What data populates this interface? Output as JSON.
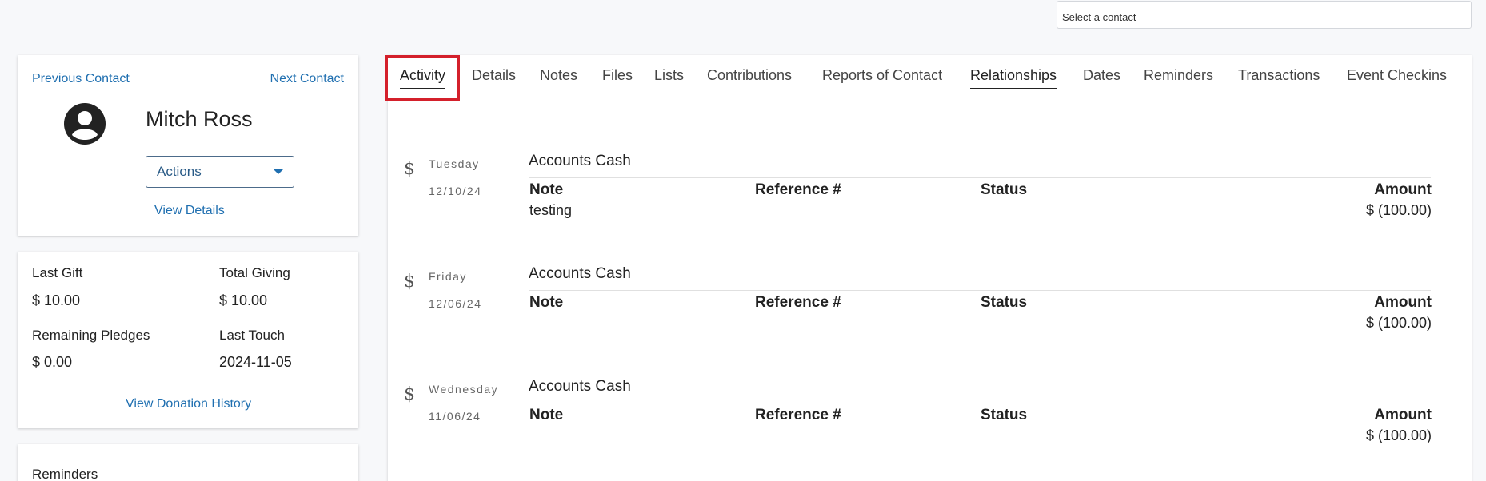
{
  "contact_select": {
    "placeholder": "Select a contact"
  },
  "contact_card": {
    "previous_label": "Previous Contact",
    "next_label": "Next Contact",
    "name": "Mitch Ross",
    "actions_label": "Actions",
    "view_details_label": "View Details",
    "avatar_icon": "user-circle-icon"
  },
  "stats": {
    "last_gift_label": "Last Gift",
    "last_gift_value": "$ 10.00",
    "total_giving_label": "Total Giving",
    "total_giving_value": "$ 10.00",
    "remaining_pledges_label": "Remaining Pledges",
    "remaining_pledges_value": "$ 0.00",
    "last_touch_label": "Last Touch",
    "last_touch_value": "2024-11-05",
    "view_history_label": "View Donation History"
  },
  "reminders": {
    "title": "Reminders"
  },
  "tabs": [
    {
      "label": "Activity"
    },
    {
      "label": "Details"
    },
    {
      "label": "Notes"
    },
    {
      "label": "Files"
    },
    {
      "label": "Lists"
    },
    {
      "label": "Contributions"
    },
    {
      "label": "Reports of Contact"
    },
    {
      "label": "Relationships"
    },
    {
      "label": "Dates"
    },
    {
      "label": "Reminders"
    },
    {
      "label": "Transactions"
    },
    {
      "label": "Event Checkins"
    }
  ],
  "columns": {
    "note": "Note",
    "reference": "Reference #",
    "status": "Status",
    "amount": "Amount"
  },
  "entries": [
    {
      "icon": "$",
      "weekday": "Tuesday",
      "date": "12/10/24",
      "account": "Accounts Cash",
      "note": "testing",
      "amount": "$ (100.00)"
    },
    {
      "icon": "$",
      "weekday": "Friday",
      "date": "12/06/24",
      "account": "Accounts Cash",
      "note": "",
      "amount": "$ (100.00)"
    },
    {
      "icon": "$",
      "weekday": "Wednesday",
      "date": "11/06/24",
      "account": "Accounts Cash",
      "note": "",
      "amount": "$ (100.00)"
    }
  ],
  "colors": {
    "link": "#1f6fb0",
    "highlight": "#d4202b",
    "background": "#f7f8fa"
  }
}
